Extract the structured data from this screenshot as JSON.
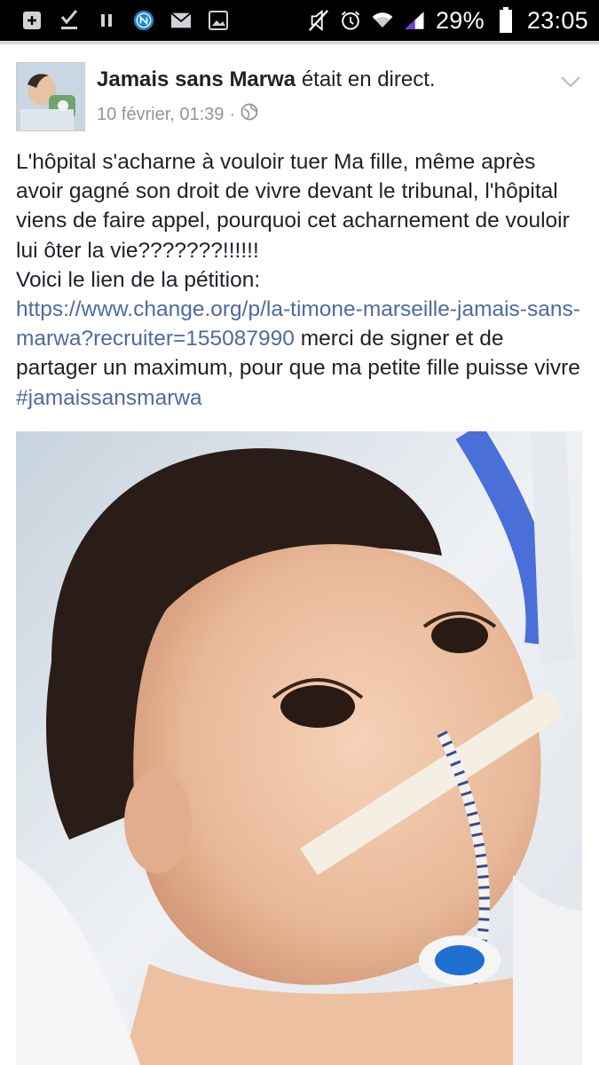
{
  "status_bar": {
    "battery_pct": "29%",
    "time": "23:05",
    "icons": [
      "add-box-icon",
      "checkmark-download-icon",
      "pause-icon",
      "nfc-icon",
      "mail-icon",
      "image-icon",
      "mute-icon",
      "alarm-icon",
      "wifi-icon",
      "signal-icon",
      "battery-icon"
    ]
  },
  "post": {
    "author": "Jamais sans Marwa",
    "action": "était en direct.",
    "date": "10 février, 01:39",
    "dot": "·",
    "body_line1": "L'hôpital s'acharne à vouloir tuer Ma fille, même après avoir gagné son droit de vivre devant le tribunal, l'hôpital viens de faire appel, pourquoi cet acharnement de vouloir lui ôter la vie???????!!!!!!",
    "body_line2": "Voici le lien de la pétition:",
    "link": "https://www.change.org/p/la-timone-marseille-jamais-sans-marwa?recruiter=155087990",
    "body_after_link": " merci de signer et de partager un maximum, pour que ma petite fille puisse vivre ",
    "hashtag": "#jamaissansmarwa"
  },
  "colors": {
    "link": "#4e6aa1",
    "meta": "#90949c",
    "text": "#1d2129"
  }
}
